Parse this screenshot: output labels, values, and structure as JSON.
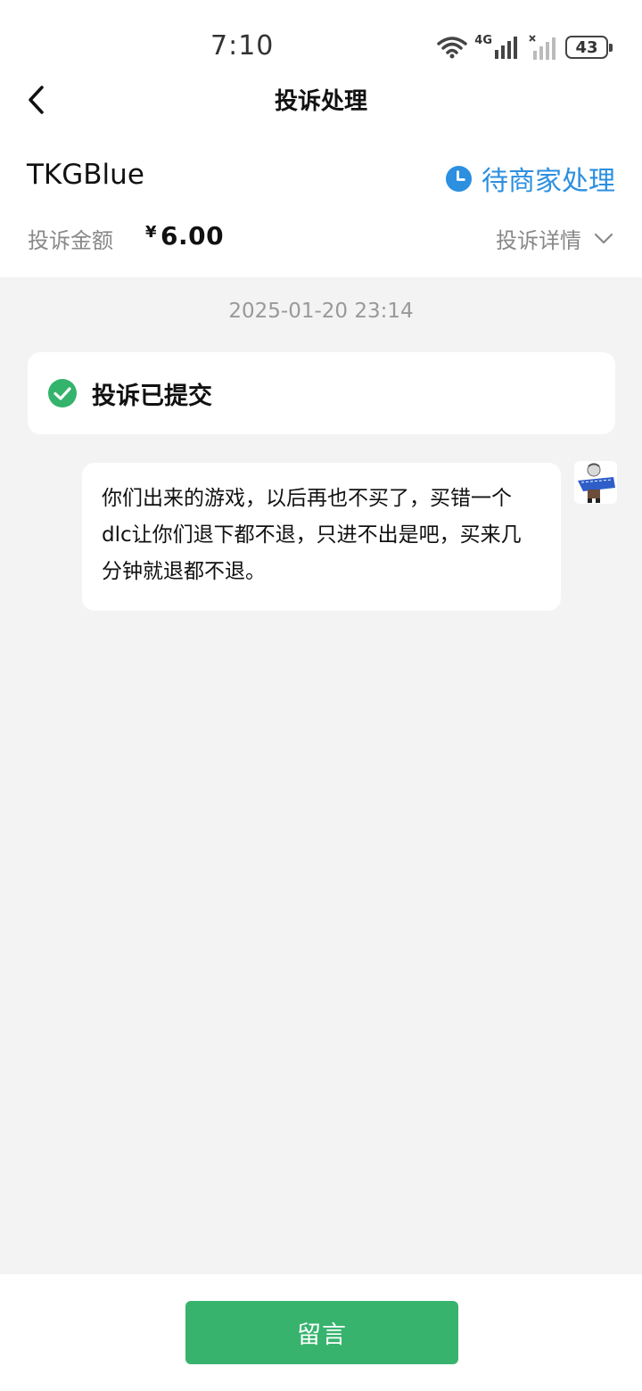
{
  "status_bar": {
    "time": "7:10",
    "network_label": "4G",
    "battery": "43"
  },
  "nav": {
    "title": "投诉处理"
  },
  "merchant": {
    "name": "TKGBlue",
    "status": "待商家处理",
    "status_color": "#2c8fe0"
  },
  "complaint": {
    "amount_label": "投诉金额",
    "currency": "¥",
    "amount": "6.00",
    "details_label": "投诉详情"
  },
  "timeline": {
    "timestamp": "2025-01-20 23:14",
    "submitted_text": "投诉已提交"
  },
  "message": {
    "text": "你们出来的游戏，以后再也不买了，买错一个dlc让你们退下都不退，只进不出是吧，买来几分钟就退都不退。"
  },
  "actions": {
    "reply_label": "留言",
    "reply_color": "#37b36e"
  }
}
